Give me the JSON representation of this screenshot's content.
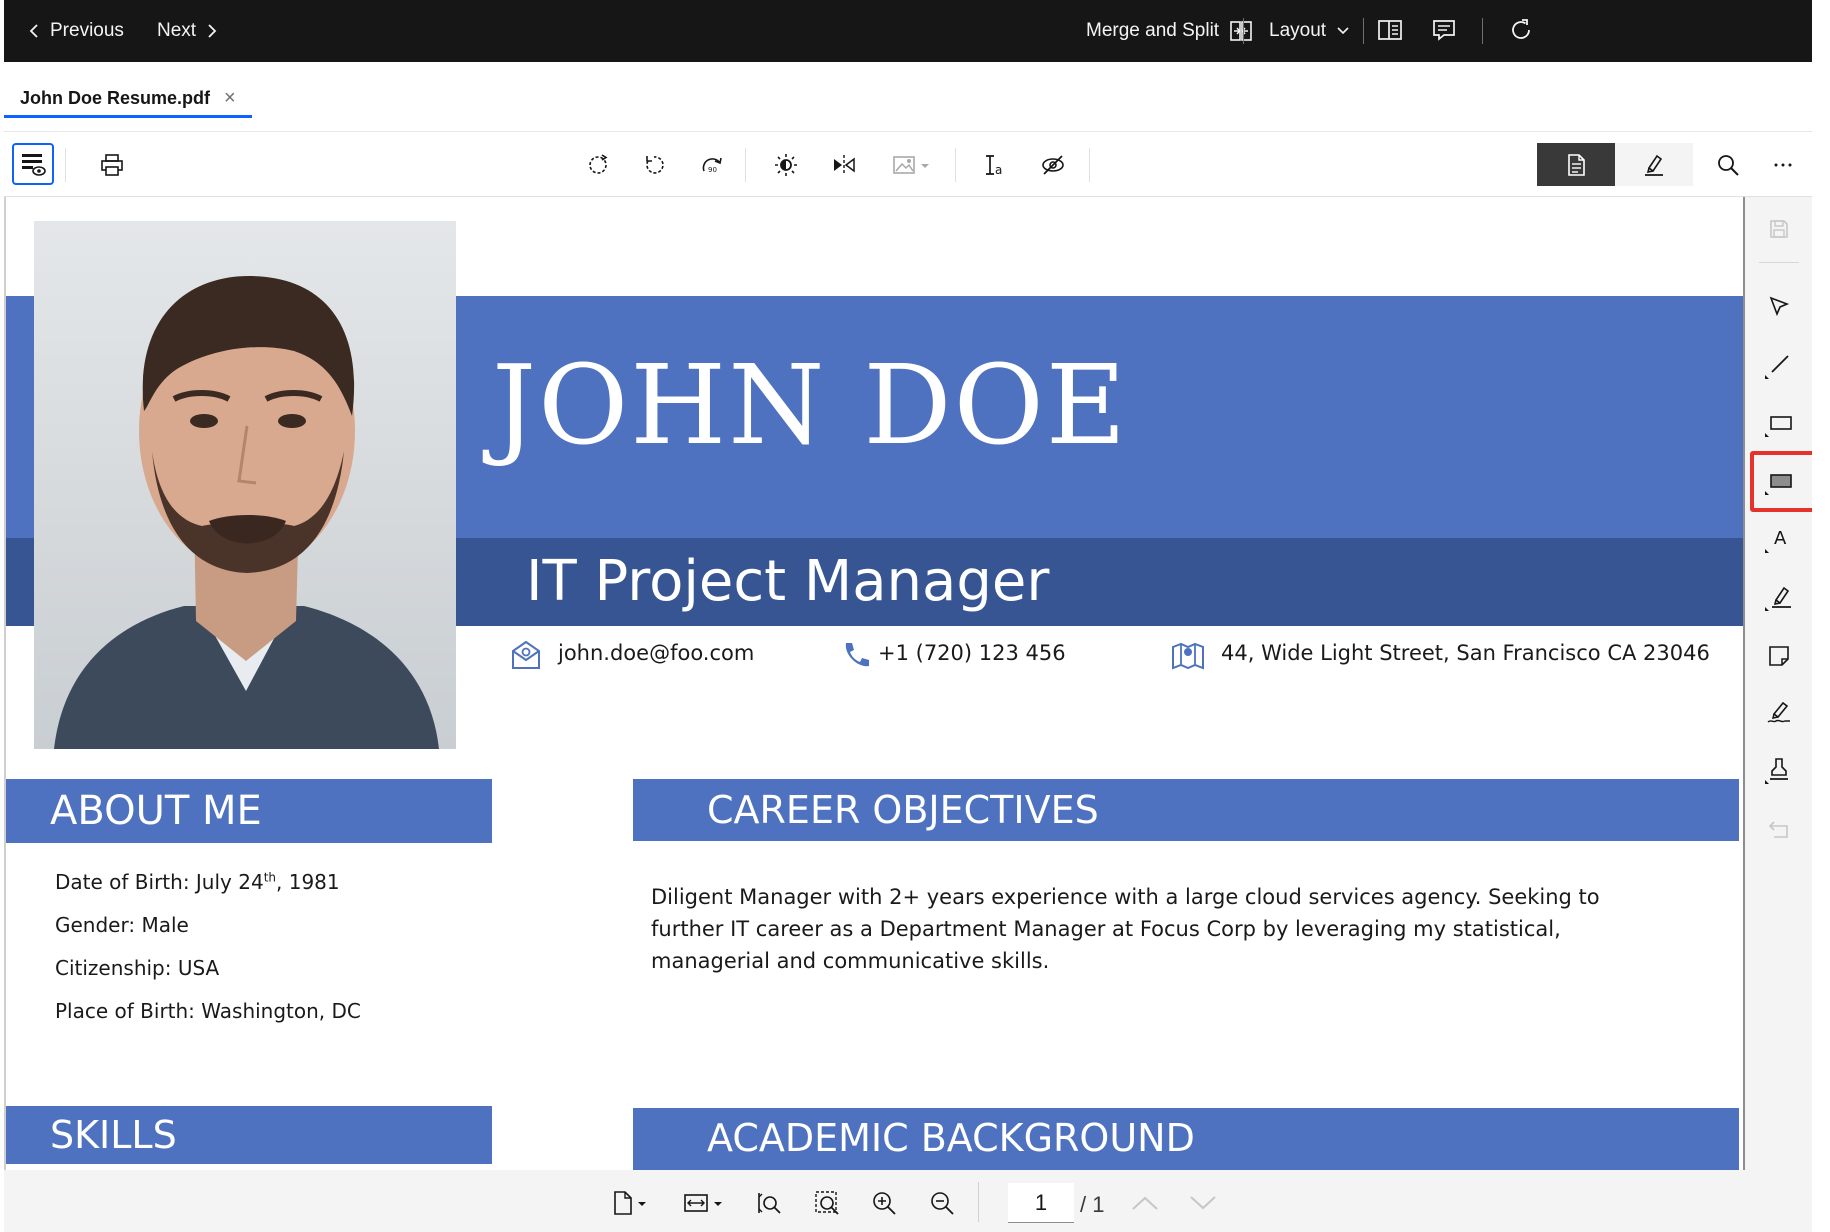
{
  "topbar": {
    "previous_label": "Previous",
    "next_label": "Next",
    "merge_split_label": "Merge and Split",
    "layout_label": "Layout"
  },
  "tab": {
    "title": "John Doe Resume.pdf",
    "close_glyph": "×"
  },
  "resume": {
    "name": "JOHN DOE",
    "role": "IT Project Manager",
    "email": "john.doe@foo.com",
    "phone": "+1 (720) 123 456",
    "address": "44, Wide Light Street, San Francisco CA 23046",
    "about_heading": "ABOUT ME",
    "about_items": {
      "dob_prefix": "Date of Birth: July 24",
      "dob_sup": "th",
      "dob_suffix": ", 1981",
      "gender": "Gender: Male",
      "citizenship": "Citizenship: USA",
      "place_of_birth": "Place of Birth: Washington, DC"
    },
    "career_heading": "CAREER OBJECTIVES",
    "career_lines": [
      "Diligent Manager with 2+ years experience with a large cloud services agency. Seeking to",
      "further IT career as a Department Manager at Focus Corp  by leveraging my statistical,",
      "managerial and communicative skills."
    ],
    "skills_heading": "SKILLS",
    "academic_heading": "ACADEMIC BACKGROUND"
  },
  "pager": {
    "current_page": "1",
    "total": "/ 1"
  },
  "colors": {
    "topbar_bg": "#161616",
    "resume_blue": "#4e72bf",
    "resume_dark_blue": "#365592",
    "highlight_red": "#e5322d",
    "tab_underline": "#0f62fe"
  },
  "icons": {
    "toolbar": [
      "view-settings-icon",
      "print-icon",
      "rotate-icon",
      "rotate-left-icon",
      "rotate-right-icon",
      "brightness-icon",
      "flip-icon",
      "image-icon",
      "text-recognition-icon",
      "hide-icon",
      "document-view-icon",
      "annotate-icon",
      "search-icon",
      "overflow-menu-icon"
    ],
    "rail": [
      "save-icon",
      "select-icon",
      "line-icon",
      "rectangle-icon",
      "filled-rectangle-icon",
      "text-icon",
      "highlighter-icon",
      "sticky-note-icon",
      "signature-icon",
      "stamp-icon",
      "undo-icon"
    ],
    "bottom": [
      "page-fit-icon",
      "fit-width-icon",
      "zoom-fit-icon",
      "zoom-area-icon",
      "zoom-in-icon",
      "zoom-out-icon",
      "page-up-icon",
      "page-down-icon"
    ]
  }
}
